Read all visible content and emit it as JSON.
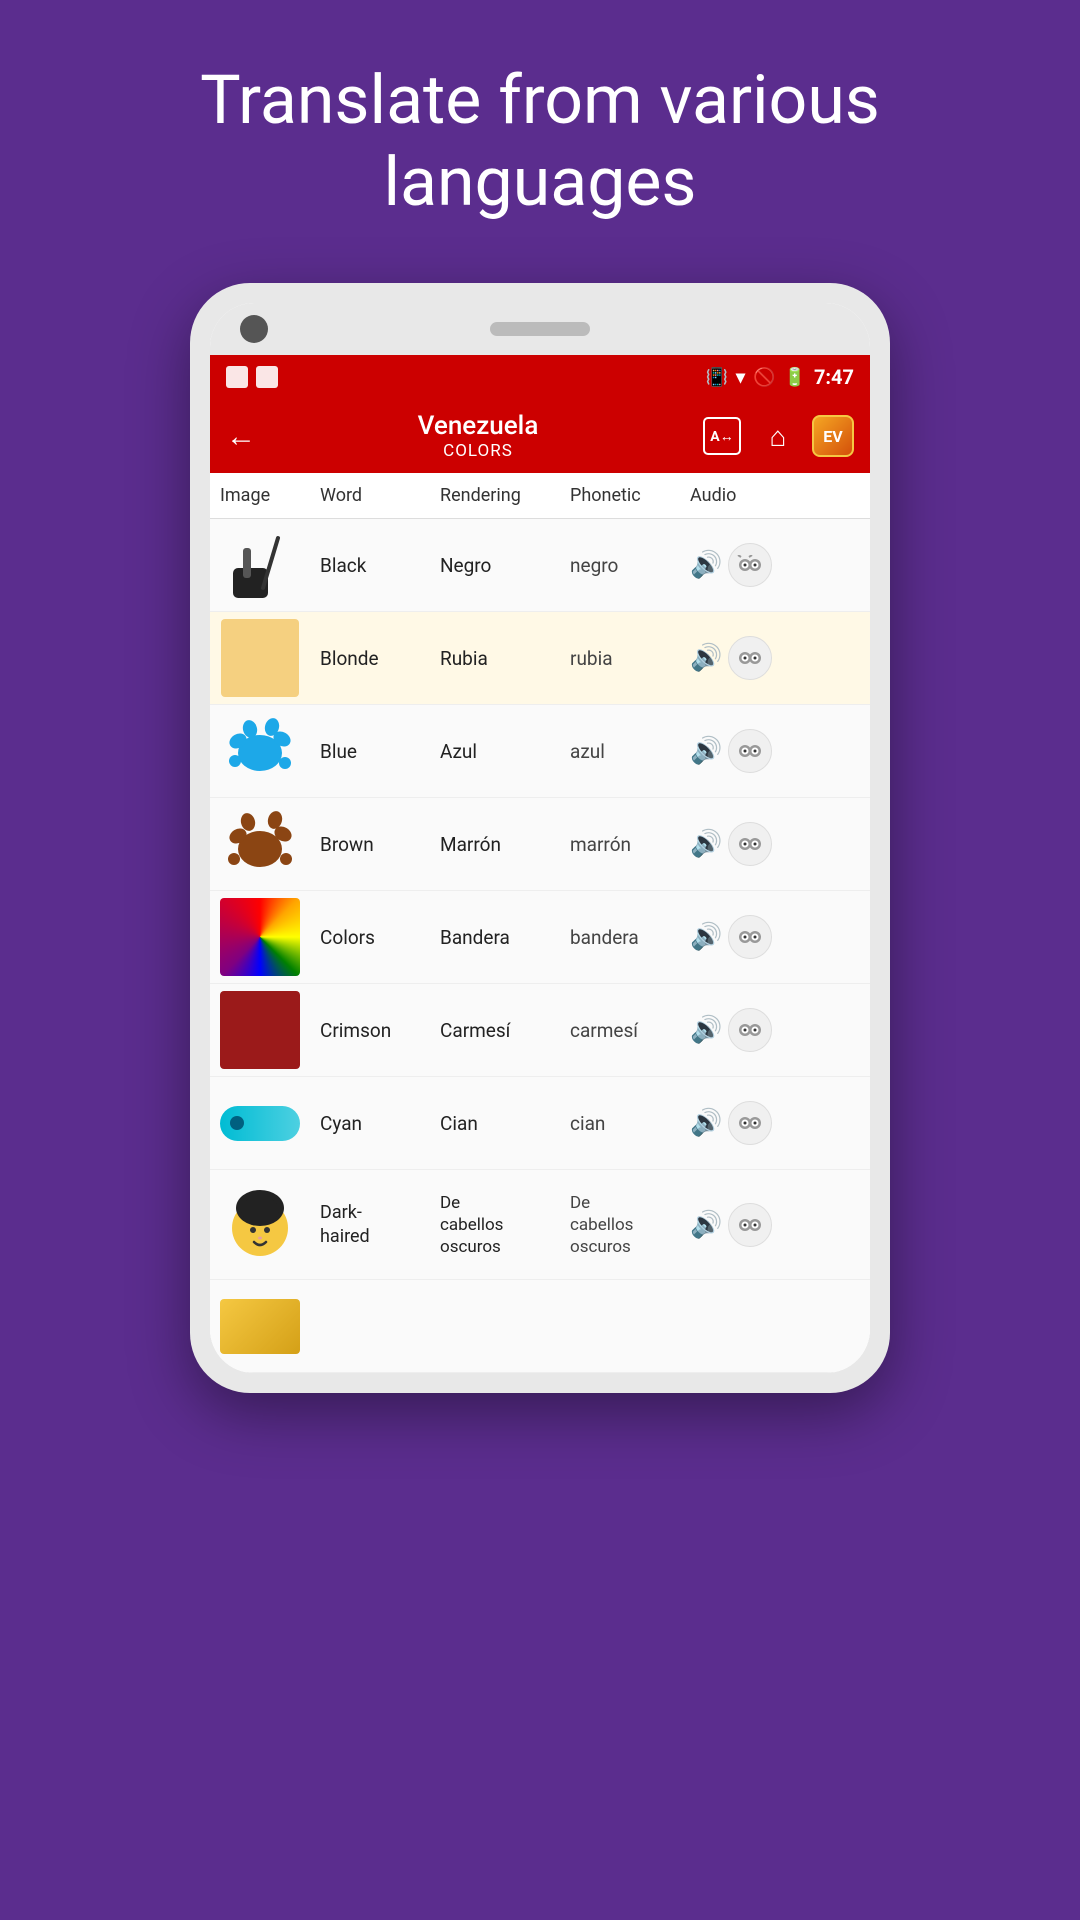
{
  "hero": {
    "text": "Translate from various languages"
  },
  "status_bar": {
    "time": "7:47"
  },
  "header": {
    "back_label": "←",
    "title": "Venezuela",
    "subtitle": "COLORS",
    "ev_label": "EV"
  },
  "table": {
    "columns": [
      "Image",
      "Word",
      "Rendering",
      "Phonetic",
      "Audio"
    ],
    "rows": [
      {
        "word": "Black",
        "rendering": "Negro",
        "phonetic": "negro",
        "image_type": "black"
      },
      {
        "word": "Blonde",
        "rendering": "Rubia",
        "phonetic": "rubia",
        "image_type": "blonde"
      },
      {
        "word": "Blue",
        "rendering": "Azul",
        "phonetic": "azul",
        "image_type": "blue"
      },
      {
        "word": "Brown",
        "rendering": "Marrón",
        "phonetic": "marrón",
        "image_type": "brown"
      },
      {
        "word": "Colors",
        "rendering": "Bandera",
        "phonetic": "bandera",
        "image_type": "colors"
      },
      {
        "word": "Crimson",
        "rendering": "Carmesí",
        "phonetic": "carmesí",
        "image_type": "crimson"
      },
      {
        "word": "Cyan",
        "rendering": "Cian",
        "phonetic": "cian",
        "image_type": "cyan"
      },
      {
        "word": "Dark-haired",
        "rendering": "De cabellos oscuros",
        "phonetic": "De cabellos oscuros",
        "image_type": "dark-haired"
      },
      {
        "word": "",
        "rendering": "",
        "phonetic": "",
        "image_type": "gold"
      }
    ]
  }
}
